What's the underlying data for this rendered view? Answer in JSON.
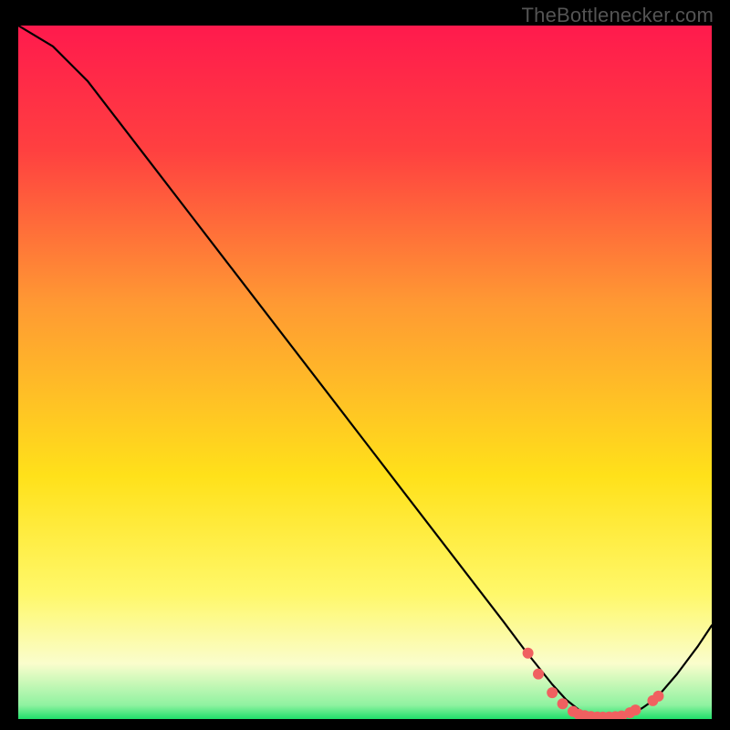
{
  "watermark": "TheBottlenecker.com",
  "chart_data": {
    "type": "line",
    "title": "",
    "xlabel": "",
    "ylabel": "",
    "xlim": [
      0,
      100
    ],
    "ylim": [
      0,
      100
    ],
    "grid": false,
    "legend": false,
    "background_gradient": {
      "stops": [
        {
          "offset": 0.0,
          "color": "#ff1a4d"
        },
        {
          "offset": 0.18,
          "color": "#ff4040"
        },
        {
          "offset": 0.4,
          "color": "#ff9933"
        },
        {
          "offset": 0.65,
          "color": "#ffe11a"
        },
        {
          "offset": 0.82,
          "color": "#fff86a"
        },
        {
          "offset": 0.92,
          "color": "#fafdcc"
        },
        {
          "offset": 0.98,
          "color": "#8ff2a0"
        },
        {
          "offset": 1.0,
          "color": "#1fe06a"
        }
      ]
    },
    "series": [
      {
        "name": "bottleneck-curve",
        "x": [
          0,
          5,
          8,
          10,
          15,
          20,
          25,
          30,
          35,
          40,
          45,
          50,
          55,
          60,
          65,
          70,
          73,
          75,
          77,
          79,
          81,
          83,
          85,
          87,
          89,
          90,
          92,
          95,
          98,
          100
        ],
        "y": [
          100,
          97,
          94,
          92,
          85.5,
          79,
          72.5,
          66,
          59.5,
          53,
          46.5,
          40,
          33.5,
          27,
          20.5,
          14,
          10,
          7.5,
          5,
          2.8,
          1.2,
          0.5,
          0.3,
          0.3,
          1.0,
          1.6,
          3.0,
          6.5,
          10.5,
          13.5
        ]
      }
    ],
    "markers": {
      "name": "data-points",
      "x": [
        73.5,
        75.0,
        77.0,
        78.5,
        80.0,
        80.8,
        81.7,
        82.6,
        83.5,
        84.3,
        85.2,
        86.1,
        87.0,
        88.2,
        89.0,
        91.5,
        92.3
      ],
      "y": [
        9.5,
        6.5,
        3.8,
        2.2,
        1.1,
        0.7,
        0.5,
        0.36,
        0.3,
        0.28,
        0.3,
        0.35,
        0.45,
        0.9,
        1.3,
        2.65,
        3.3
      ],
      "color": "#f06060",
      "radius": 6
    }
  }
}
